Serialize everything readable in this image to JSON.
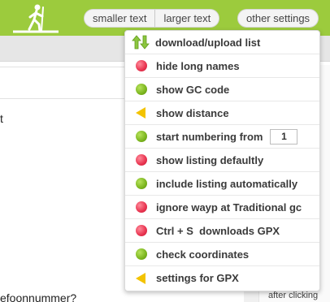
{
  "header": {
    "logo_icon": "hiker-icon",
    "text_size_buttons": [
      "smaller text",
      "larger text"
    ],
    "other_settings_label": "other settings"
  },
  "background": {
    "fragment_t": "t",
    "fragment_phone": "efoonnummer?",
    "fragment_after": "after clicking"
  },
  "menu": {
    "items": [
      {
        "icon": "up-down-arrows-icon",
        "label": "download/upload list"
      },
      {
        "icon": "red-dot-icon",
        "label": "hide long names"
      },
      {
        "icon": "green-dot-icon",
        "label": "show GC code"
      },
      {
        "icon": "yellow-arrow-icon",
        "label": "show distance"
      },
      {
        "icon": "green-dot-icon",
        "label": "start numbering from",
        "value": "1"
      },
      {
        "icon": "red-dot-icon",
        "label": "show listing defaultly"
      },
      {
        "icon": "green-dot-icon",
        "label": "include listing automatically"
      },
      {
        "icon": "red-dot-icon",
        "label": "ignore wayp at Traditional gc"
      },
      {
        "icon": "red-dot-icon",
        "label": "Ctrl + S  downloads GPX"
      },
      {
        "icon": "green-dot-icon",
        "label": "check coordinates"
      },
      {
        "icon": "yellow-arrow-icon",
        "label": "settings for GPX"
      }
    ]
  },
  "colors": {
    "header_green": "#9ccb3d",
    "status_red": "#e8334f",
    "status_green": "#7bb51e",
    "arrow_yellow": "#f3c300"
  }
}
